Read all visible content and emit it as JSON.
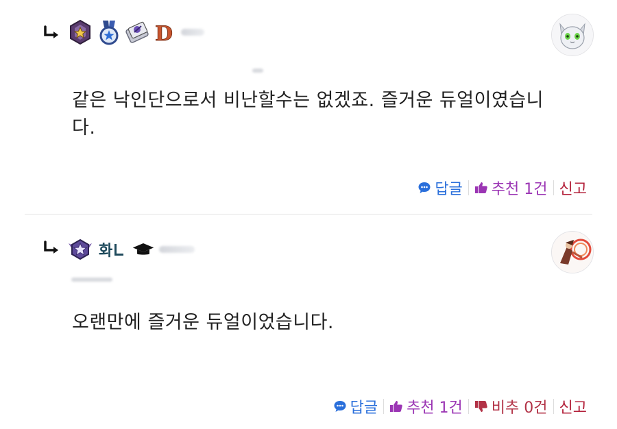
{
  "comments": [
    {
      "text": "같은 낙인단으로서 비난할수는 없겠죠. 즐거운 듀얼이였습니다.",
      "text_line1": "같은 낙인단으로서 비난할수는 없겠죠. 즐거운 듀얼이였습니",
      "text_line2": "다.",
      "badge_letter": "D",
      "actions": {
        "reply_label": "답글",
        "recommend_label": "추천 1건",
        "report_label": "신고"
      }
    },
    {
      "text": "오랜만에 즐거운 듀얼이었습니다.",
      "badge_text": "화",
      "actions": {
        "reply_label": "답글",
        "recommend_label": "추천 1건",
        "downvote_label": "비추 0건",
        "report_label": "신고"
      }
    }
  ],
  "colors": {
    "reply": "#2a6fdb",
    "recommend": "#9b35b4",
    "downvote": "#b23246",
    "report": "#b3203a"
  },
  "icons": [
    "reply-arrow-icon",
    "rank-badge-icon",
    "medal-icon",
    "card-icon",
    "grade-letter-icon",
    "graduation-cap-icon",
    "chat-bubble-icon",
    "thumbs-up-icon",
    "thumbs-down-icon"
  ]
}
